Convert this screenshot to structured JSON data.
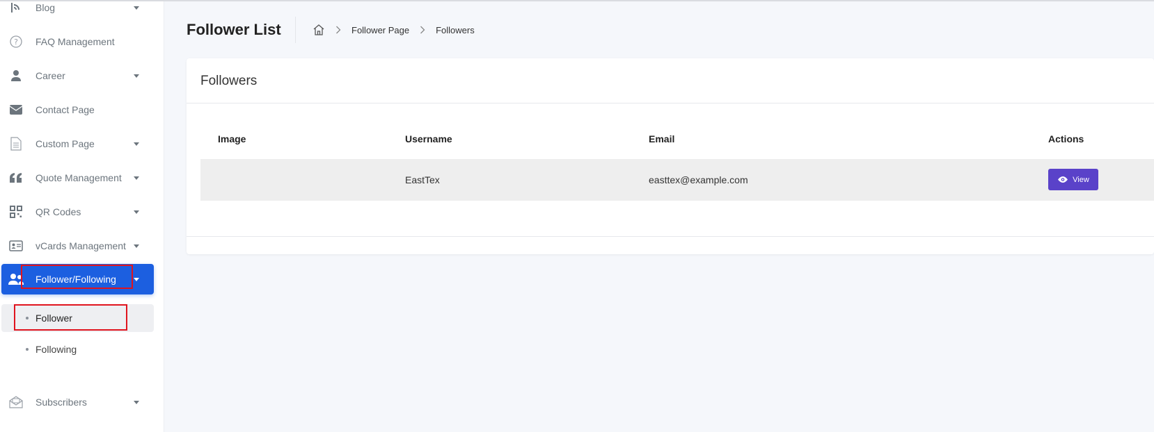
{
  "sidebar": {
    "items": [
      {
        "label": "Blog",
        "icon": "blog-icon",
        "has_caret": true
      },
      {
        "label": "FAQ Management",
        "icon": "question-circle-icon",
        "has_caret": false
      },
      {
        "label": "Career",
        "icon": "user-tie-icon",
        "has_caret": true
      },
      {
        "label": "Contact Page",
        "icon": "envelope-icon",
        "has_caret": false
      },
      {
        "label": "Custom Page",
        "icon": "file-icon",
        "has_caret": true
      },
      {
        "label": "Quote Management",
        "icon": "quote-icon",
        "has_caret": true
      },
      {
        "label": "QR Codes",
        "icon": "qrcode-icon",
        "has_caret": true
      },
      {
        "label": "vCards Management",
        "icon": "id-card-icon",
        "has_caret": true
      },
      {
        "label": "Follower/Following",
        "icon": "users-icon",
        "has_caret": true,
        "active": true
      },
      {
        "label": "Subscribers",
        "icon": "mail-open-icon",
        "has_caret": true
      }
    ],
    "submenu": [
      {
        "label": "Follower",
        "current": true
      },
      {
        "label": "Following",
        "current": false
      }
    ]
  },
  "header": {
    "title": "Follower List",
    "breadcrumb": [
      "Follower Page",
      "Followers"
    ]
  },
  "card": {
    "title": "Followers",
    "table": {
      "columns": [
        "Image",
        "Username",
        "Email",
        "Actions"
      ],
      "rows": [
        {
          "image": "",
          "username": "EastTex",
          "email": "easttex@example.com",
          "action_label": "View"
        }
      ]
    }
  },
  "colors": {
    "accent": "#1c5fe0",
    "view_button": "#5a42c9",
    "highlight": "#e0141e",
    "background": "#f5f7fb"
  }
}
